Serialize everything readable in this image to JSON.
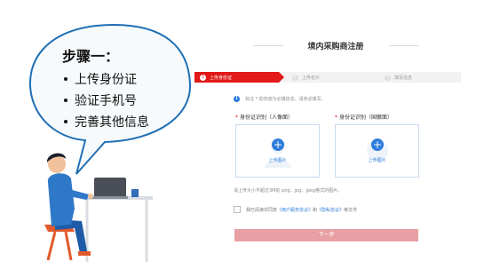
{
  "bubble": {
    "title": "步骤一：",
    "items": [
      "上传身份证",
      "验证手机号",
      "完善其他信息"
    ]
  },
  "page": {
    "title": "境内采购商注册"
  },
  "steps": [
    {
      "num": "1",
      "label": "上传身份证",
      "active": true
    },
    {
      "num": "2",
      "label": "上传名片",
      "active": false
    },
    {
      "num": "3",
      "label": "填写信息",
      "active": false
    }
  ],
  "notice": {
    "icon": "i",
    "text": "标注 * 的内容为必填信息，请务必填写。"
  },
  "upload": {
    "front": {
      "label": "身份证识别（人像面）",
      "button": "上传图片"
    },
    "back": {
      "label": "身份证识别（国徽面）",
      "button": "上传图片"
    },
    "required_mark": "*"
  },
  "size_note": "请上传大小不超过3M的 png、jpg、jpeg格式的图片。",
  "agreement": {
    "prefix": "我已阅读并同意",
    "link1": "《用户服务协议》",
    "and": "和",
    "link2": "《隐私协议》",
    "suffix": "等文件"
  },
  "next_button": "下一步",
  "colors": {
    "accent": "#e21918",
    "link": "#2f7ddb",
    "button_disabled": "#e8a0a4"
  }
}
